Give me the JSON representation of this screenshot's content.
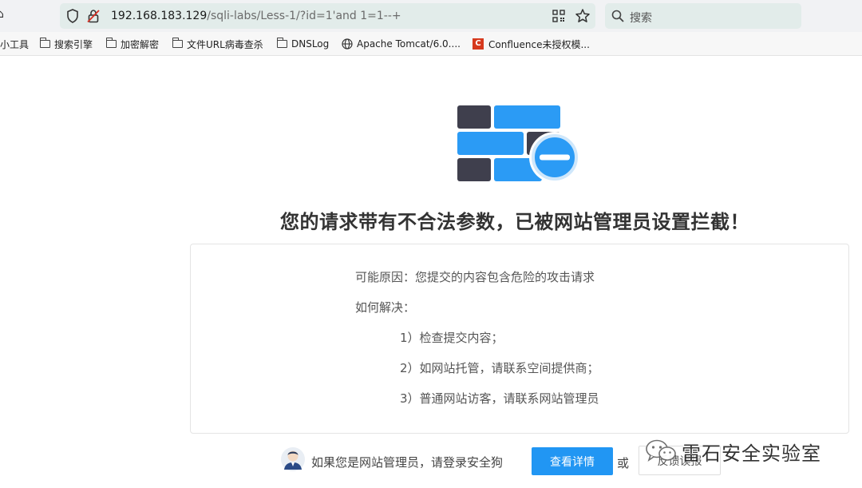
{
  "browser": {
    "url_host": "192.168.183.129",
    "url_path": "/sqli-labs/Less-1/?id=1'and 1=1--+",
    "search_placeholder": "搜索",
    "bookmarks": [
      {
        "label": "小工具",
        "icon": "folder-icon"
      },
      {
        "label": "搜索引擎",
        "icon": "folder-icon"
      },
      {
        "label": "加密解密",
        "icon": "folder-icon"
      },
      {
        "label": "文件URL病毒查杀",
        "icon": "folder-icon"
      },
      {
        "label": "DNSLog",
        "icon": "folder-icon"
      },
      {
        "label": "Apache Tomcat/6.0....",
        "icon": "globe-icon"
      },
      {
        "label": "Confluence未授权模...",
        "icon": "confluence-icon"
      }
    ]
  },
  "page": {
    "headline": "您的请求带有不合法参数，已被网站管理员设置拦截！",
    "reason": "可能原因：您提交的内容包含危险的攻击请求",
    "howto_title": "如何解决：",
    "steps": [
      "1）检查提交内容；",
      "2）如网站托管，请联系空间提供商；",
      "3）普通网站访客，请联系网站管理员"
    ],
    "admin_prompt": "如果您是网站管理员，请登录安全狗",
    "detail_button": "查看详情",
    "or_text": "或",
    "report_button": "反馈误报"
  },
  "watermark": {
    "text": "雷石安全实验室",
    "icon": "wechat-icon"
  },
  "colors": {
    "accent": "#2196f3",
    "brick_dark": "#3f3f4d",
    "brick_blue": "#2b9bf5"
  }
}
